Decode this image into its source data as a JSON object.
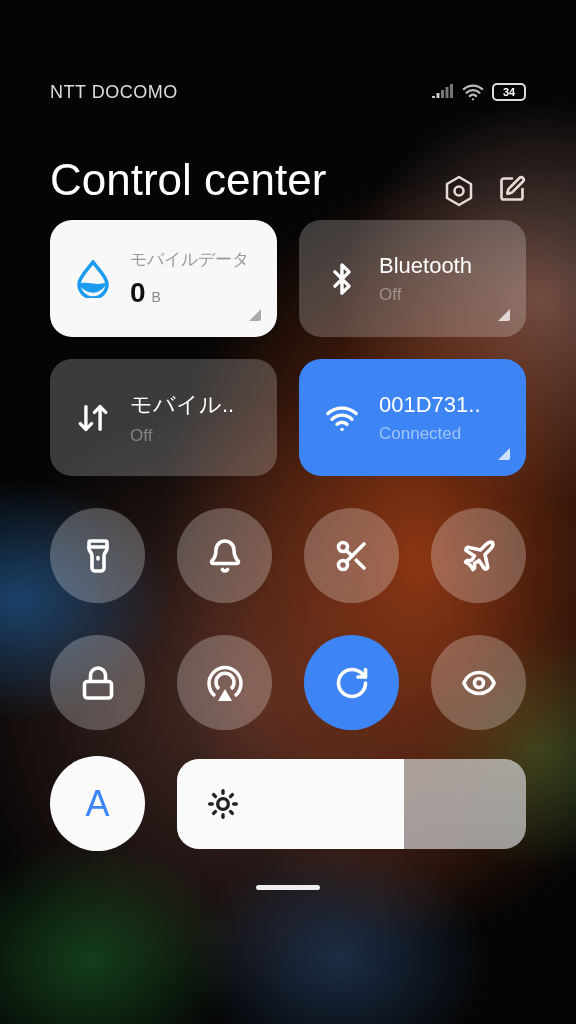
{
  "status_bar": {
    "carrier": "NTT DOCOMO",
    "battery": "34"
  },
  "header": {
    "title": "Control center"
  },
  "tiles": [
    {
      "kind": "usage",
      "label": "モバイルデータ",
      "value": "0",
      "unit": "B",
      "expandable": true
    },
    {
      "kind": "toggle",
      "title": "Bluetooth",
      "status": "Off",
      "on": false,
      "expandable": true
    },
    {
      "kind": "toggle",
      "title": "モバイル..",
      "status": "Off",
      "on": false,
      "expandable": false
    },
    {
      "kind": "toggle",
      "title": "001D731..",
      "status": "Connected",
      "on": true,
      "expandable": true
    }
  ],
  "toggles": [
    {
      "on": false
    },
    {
      "on": false
    },
    {
      "on": false
    },
    {
      "on": false
    },
    {
      "on": false
    },
    {
      "on": false
    },
    {
      "on": true
    },
    {
      "on": false
    }
  ],
  "auto_brightness": {
    "label": "A",
    "on": true
  },
  "brightness": {
    "level": 0.65
  }
}
